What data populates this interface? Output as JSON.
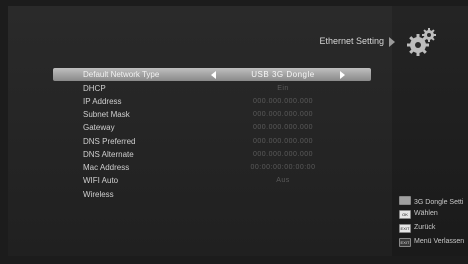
{
  "title": "Ethernet Setting",
  "settings": [
    {
      "label": "Default Network Type",
      "value": "USB 3G Dongle",
      "selected": true
    },
    {
      "label": "DHCP",
      "value": "Ein"
    },
    {
      "label": "IP Address",
      "value": "000.000.000.000"
    },
    {
      "label": "Subnet Mask",
      "value": "000.000.000.000"
    },
    {
      "label": "Gateway",
      "value": "000.000.000.000"
    },
    {
      "label": "DNS Preferred",
      "value": "000.000.000.000"
    },
    {
      "label": "DNS Alternate",
      "value": "000.000.000.000"
    },
    {
      "label": "Mac Address",
      "value": "00:00:00:00:00:00"
    },
    {
      "label": "WIFI Auto",
      "value": "Aus"
    },
    {
      "label": "Wireless",
      "value": ""
    }
  ],
  "legend": [
    {
      "key": "",
      "text": "3G Dongle Setti"
    },
    {
      "key": "OK",
      "text": "Wählen"
    },
    {
      "key": "EXIT",
      "text": "Zurück"
    },
    {
      "key": "EXIT",
      "text": "Menü Verlassen"
    }
  ]
}
